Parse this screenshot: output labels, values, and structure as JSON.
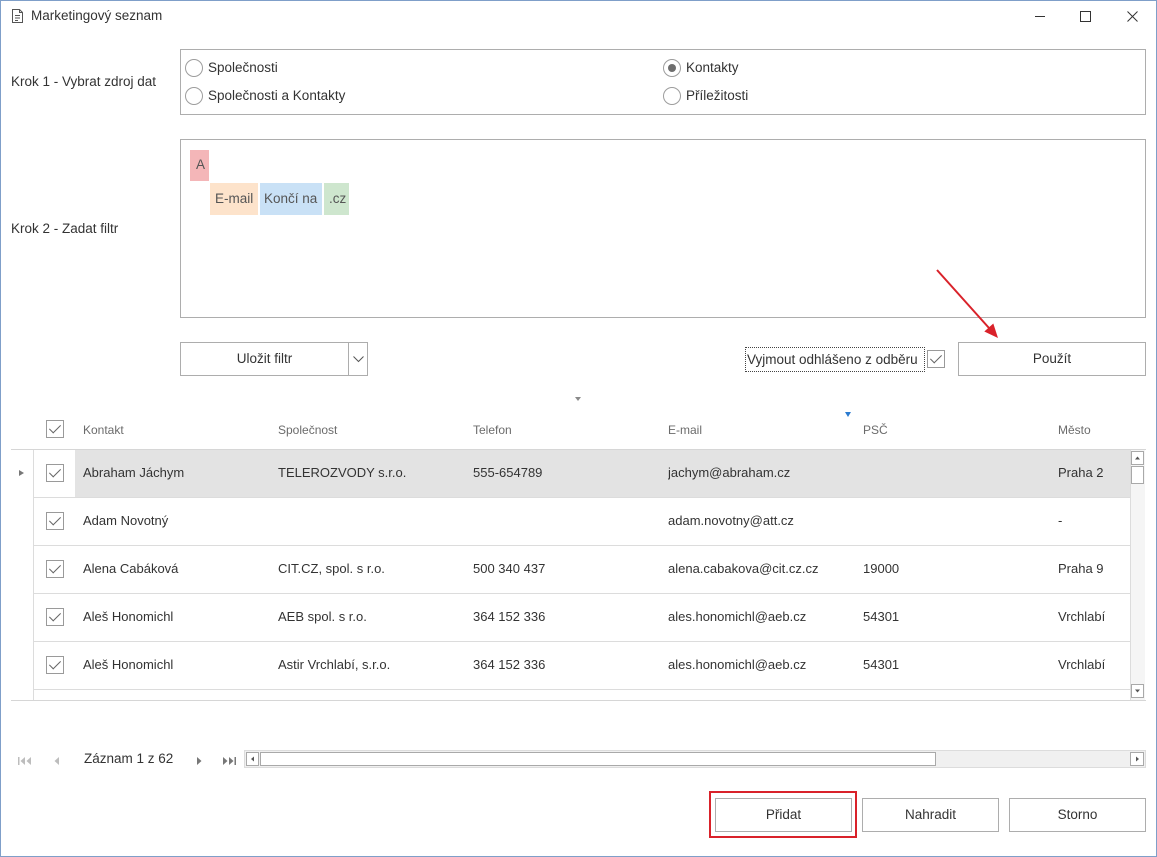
{
  "window": {
    "title": "Marketingový seznam",
    "icon": "list-document-icon",
    "controls": [
      "minimize-icon",
      "maximize-icon",
      "close-icon"
    ]
  },
  "step1": {
    "label": "Krok 1 - Vybrat zdroj dat",
    "options": [
      {
        "label": "Společnosti",
        "selected": false
      },
      {
        "label": "Kontakty",
        "selected": true
      },
      {
        "label": "Společnosti a Kontakty",
        "selected": false
      },
      {
        "label": "Příležitosti",
        "selected": false
      }
    ]
  },
  "step2": {
    "label": "Krok 2 - Zadat filtr",
    "filter": {
      "group_operator": "A",
      "conditions": [
        {
          "field": "E-mail",
          "operator": "Končí na",
          "value": ".cz"
        }
      ]
    }
  },
  "actions": {
    "save_filter_label": "Uložit filtr",
    "exclude_unsubscribed_label": "Vyjmout odhlášeno z odběru",
    "exclude_unsubscribed_checked": true,
    "apply_label": "Použít"
  },
  "grid": {
    "select_all_checked": true,
    "columns": [
      "Kontakt",
      "Společnost",
      "Telefon",
      "E-mail",
      "PSČ",
      "Město"
    ],
    "rows": [
      {
        "checked": true,
        "selected": true,
        "contact": "Abraham Jáchym",
        "company": "TELEROZVODY s.r.o.",
        "phone": "555-654789",
        "email": "jachym@abraham.cz",
        "zip": "",
        "city": "Praha 2"
      },
      {
        "checked": true,
        "selected": false,
        "contact": "Adam Novotný",
        "company": "",
        "phone": "",
        "email": "adam.novotny@att.cz",
        "zip": "",
        "city": "-"
      },
      {
        "checked": true,
        "selected": false,
        "contact": "Alena Cabáková",
        "company": "CIT.CZ, spol. s r.o.",
        "phone": "500 340 437",
        "email": "alena.cabakova@cit.cz.cz",
        "zip": "19000",
        "city": "Praha 9"
      },
      {
        "checked": true,
        "selected": false,
        "contact": "Aleš Honomichl",
        "company": "AEB spol. s r.o.",
        "phone": "364 152 336",
        "email": "ales.honomichl@aeb.cz",
        "zip": "54301",
        "city": "Vrchlabí"
      },
      {
        "checked": true,
        "selected": false,
        "contact": "Aleš Honomichl",
        "company": "Astir Vrchlabí, s.r.o.",
        "phone": "364 152 336",
        "email": "ales.honomichl@aeb.cz",
        "zip": "54301",
        "city": "Vrchlabí"
      }
    ]
  },
  "navigator": {
    "record_info": "Záznam 1 z 62",
    "icons": [
      "first-record-icon",
      "previous-record-icon",
      "next-record-icon",
      "last-record-icon"
    ]
  },
  "footer": {
    "add_label": "Přidat",
    "replace_label": "Nahradit",
    "cancel_label": "Storno"
  },
  "colors": {
    "group_tag": "#f4b6b8",
    "field_tag": "#fde3cb",
    "operator_tag": "#c9e1f6",
    "value_tag": "#cee6ce",
    "selected_row": "#e3e3e3",
    "sort_indicator": "#2b7bd0",
    "annotation": "#d9222a"
  }
}
